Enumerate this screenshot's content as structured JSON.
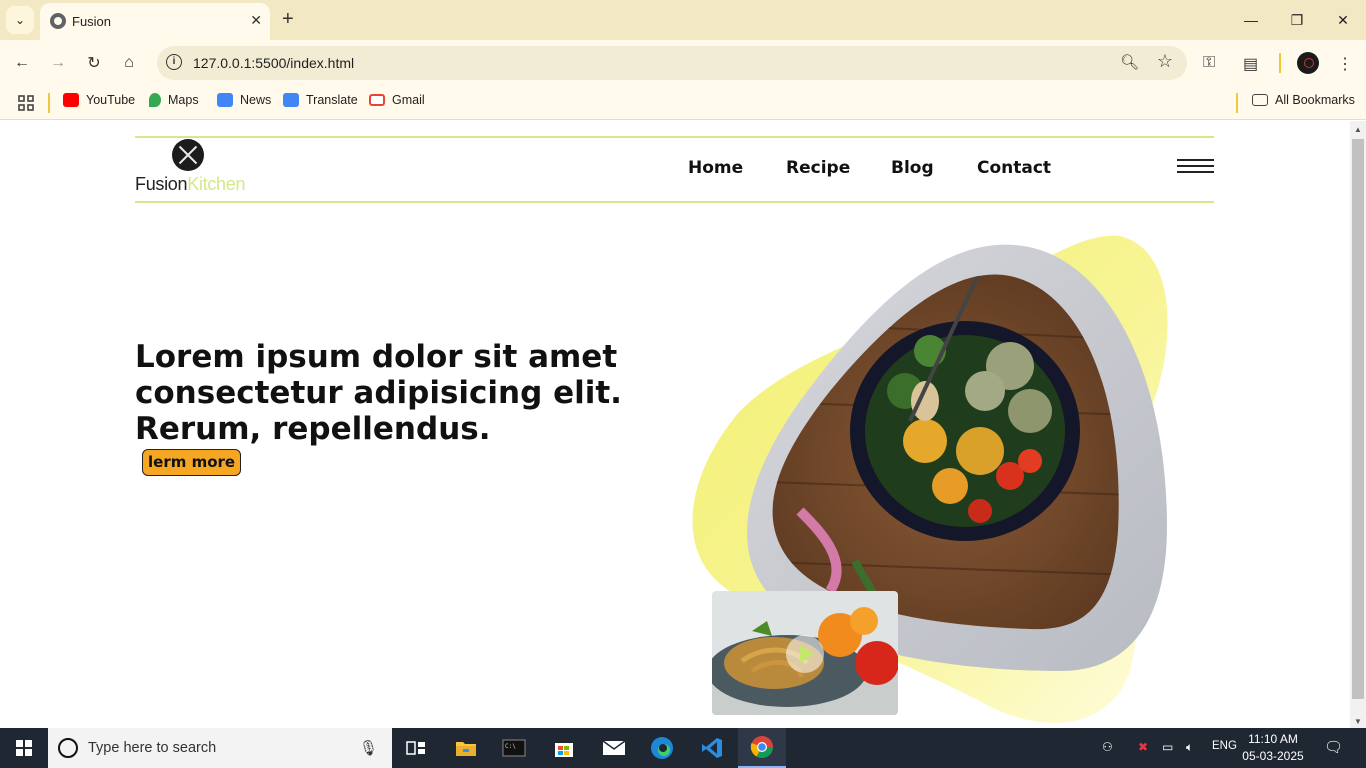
{
  "browser": {
    "tab_title": "Fusion",
    "url": "127.0.0.1:5500/index.html",
    "bookmarks": [
      {
        "label": "YouTube",
        "icon": "youtube-icon",
        "color": "#ff0000"
      },
      {
        "label": "Maps",
        "icon": "maps-icon",
        "color": "#34a853"
      },
      {
        "label": "News",
        "icon": "news-icon",
        "color": "#4285f4"
      },
      {
        "label": "Translate",
        "icon": "translate-icon",
        "color": "#4285f4"
      },
      {
        "label": "Gmail",
        "icon": "gmail-icon",
        "color": "#ea4335"
      }
    ],
    "all_bookmarks_label": "All Bookmarks"
  },
  "site": {
    "logo": {
      "word1": "Fusion",
      "word2": "Kitchen"
    },
    "nav": [
      "Home",
      "Recipe",
      "Blog",
      "Contact"
    ],
    "hero": {
      "title": "Lorem ipsum dolor sit amet consectetur adipisicing elit. Rerum, repellendus.",
      "button_label": "lerm more"
    },
    "colors": {
      "accent_green": "#d6e98a",
      "button_orange": "#f5a623",
      "blob_yellow": "#f6f07a"
    }
  },
  "taskbar": {
    "search_placeholder": "Type here to search",
    "language": "ENG",
    "time": "11:10 AM",
    "date": "05-03-2025"
  }
}
